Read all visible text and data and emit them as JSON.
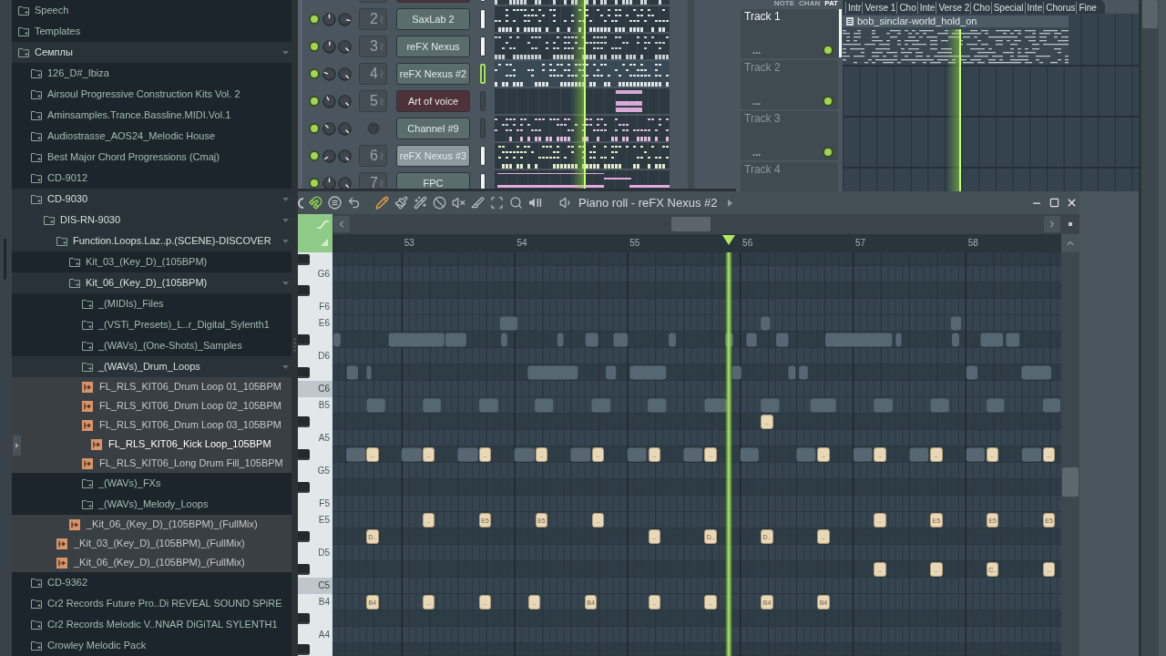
{
  "browser": {
    "items": [
      {
        "kind": "folder",
        "name": "Speech",
        "expanded": false,
        "selected": false
      },
      {
        "kind": "folder",
        "name": "Templates",
        "expanded": false,
        "selected": false
      },
      {
        "kind": "folder",
        "name": "Семплы",
        "expanded": true,
        "selected": false,
        "children": [
          {
            "kind": "folder",
            "name": "126_D#_Ibiza",
            "expanded": false,
            "selected": false
          },
          {
            "kind": "folder",
            "name": "Airsoul Progressive Construction Kits Vol. 2",
            "expanded": false,
            "selected": false
          },
          {
            "kind": "folder",
            "name": "Aminsamples.Trance.Bassline.MIDI.Vol.1",
            "expanded": false,
            "selected": false
          },
          {
            "kind": "folder",
            "name": "Audiostrasse_AOS24_Melodic House",
            "expanded": false,
            "selected": false
          },
          {
            "kind": "folder",
            "name": "Best Major Chord Progressions (Cmaj)",
            "expanded": false,
            "selected": false
          },
          {
            "kind": "folder",
            "name": "CD-9012",
            "expanded": false,
            "selected": false
          },
          {
            "kind": "folder",
            "name": "CD-9030",
            "expanded": true,
            "selected": false,
            "children": [
              {
                "kind": "folder",
                "name": "DIS-RN-9030",
                "expanded": true,
                "selected": false,
                "children": [
                  {
                    "kind": "folder",
                    "name": "Function.Loops.Laz..p.(SCENE)-DISCOVER",
                    "expanded": true,
                    "selected": false,
                    "children": [
                      {
                        "kind": "folder",
                        "name": "Kit_03_(Key_D)_(105BPM)",
                        "expanded": false,
                        "selected": false
                      },
                      {
                        "kind": "folder",
                        "name": "Kit_06_(Key_D)_(105BPM)",
                        "expanded": true,
                        "selected": false,
                        "children": [
                          {
                            "kind": "folder",
                            "name": "_(MIDIs)_Files",
                            "expanded": false,
                            "selected": false
                          },
                          {
                            "kind": "folder",
                            "name": "_(VSTi_Presets)_L..r_Digital_Sylenth1",
                            "expanded": false,
                            "selected": false
                          },
                          {
                            "kind": "folder",
                            "name": "_(WAVs)_(One-Shots)_Samples",
                            "expanded": false,
                            "selected": false
                          },
                          {
                            "kind": "folder",
                            "name": "_(WAVs)_Drum_Loops",
                            "expanded": true,
                            "selected": false,
                            "children": [
                              {
                                "kind": "file",
                                "name": "FL_RLS_KIT06_Drum Loop 01_105BPM",
                                "selected": false
                              },
                              {
                                "kind": "file",
                                "name": "FL_RLS_KIT06_Drum Loop 02_105BPM",
                                "selected": false
                              },
                              {
                                "kind": "file",
                                "name": "FL_RLS_KIT06_Drum Loop 03_105BPM",
                                "selected": false
                              },
                              {
                                "kind": "file",
                                "name": "FL_RLS_KIT06_Kick Loop_105BPM",
                                "selected": true
                              },
                              {
                                "kind": "file",
                                "name": "FL_RLS_KIT06_Long Drum Fill_105BPM",
                                "selected": false
                              }
                            ]
                          },
                          {
                            "kind": "folder",
                            "name": "_(WAVs)_FXs",
                            "expanded": false,
                            "selected": false
                          },
                          {
                            "kind": "folder",
                            "name": "_(WAVs)_Melody_Loops",
                            "expanded": false,
                            "selected": false
                          },
                          {
                            "kind": "file",
                            "name": "_Kit_06_(Key_D)_(105BPM)_(FullMix)",
                            "selected": false
                          }
                        ]
                      },
                      {
                        "kind": "file",
                        "name": "_Kit_03_(Key_D)_(105BPM)_(FullMix)",
                        "selected": false
                      },
                      {
                        "kind": "file",
                        "name": "_Kit_06_(Key_D)_(105BPM)_(FullMix)",
                        "selected": false
                      }
                    ]
                  }
                ]
              }
            ]
          },
          {
            "kind": "folder",
            "name": "CD-9362",
            "expanded": false,
            "selected": false
          },
          {
            "kind": "folder",
            "name": "Cr2 Records Future Pro..Di REVEAL SOUND SPiRE",
            "expanded": false,
            "selected": false
          },
          {
            "kind": "folder",
            "name": "Cr2 Records Melodic V..NNAR DiGiTAL SYLENTH1",
            "expanded": false,
            "selected": false
          },
          {
            "kind": "folder",
            "name": "Crowley Melodic Pack",
            "expanded": false,
            "selected": false
          }
        ]
      }
    ]
  },
  "channel_rack": {
    "channels": [
      {
        "kind": "mixer",
        "color": "#4f3239",
        "selected": true,
        "focused": false,
        "preview": {
          "kind": "dots",
          "color": "#d3d9dc"
        }
      },
      {
        "kind": "mixer",
        "number": "2",
        "name": "SaxLab 2",
        "color": "#5a6d6c",
        "selected": true,
        "focused": false,
        "on": true,
        "preview": {
          "kind": "dots",
          "color": "#dbe2e5"
        }
      },
      {
        "kind": "mixer",
        "number": "3",
        "name": "reFX Nexus",
        "color": "#5a6d6c",
        "selected": true,
        "focused": false,
        "on": true,
        "preview": {
          "kind": "dots",
          "color": "#c8cfd3"
        }
      },
      {
        "kind": "mixer",
        "number": "4",
        "name": "reFX Nexus #2",
        "color": "#5a6d6c",
        "selected": false,
        "focused": true,
        "on": true,
        "preview": {
          "kind": "dots",
          "color": "#dde3e6"
        }
      },
      {
        "kind": "mixer",
        "number": "5",
        "name": "Art of voice",
        "color": "#4f3239",
        "selected": false,
        "focused": false,
        "on": true,
        "preview": {
          "kind": "blocks",
          "color": "#d8a8d6"
        }
      },
      {
        "kind": "midi",
        "name": "Channel #9",
        "color": "#5a6d6c",
        "selected": false,
        "focused": false,
        "on": true,
        "preview": {
          "kind": "dots",
          "color": "#e0bde0"
        }
      },
      {
        "kind": "mixer",
        "number": "6",
        "name": "reFX Nexus #3",
        "color": "#8c999f",
        "selected": true,
        "focused": false,
        "on": true,
        "preview": {
          "kind": "dots",
          "color": "#e4ebcb"
        }
      },
      {
        "kind": "mixer",
        "number": "7",
        "name": "FPC",
        "color": "#5a6d6c",
        "selected": true,
        "focused": false,
        "on": true,
        "preview": {
          "kind": "bars",
          "color": "#e3a9df"
        }
      }
    ]
  },
  "playlist": {
    "modes": [
      {
        "label": "NOTE",
        "selected": false
      },
      {
        "label": "CHAN",
        "selected": false
      },
      {
        "label": "PAT",
        "selected": true
      }
    ],
    "markers": [
      "Intr",
      "Verse 1",
      "Cho",
      "Inte",
      "Verse 2",
      "Cho",
      "Special",
      "Inte",
      "Chorus",
      "Fine"
    ],
    "tracks": [
      {
        "name": "Track 1",
        "selected": true,
        "on": true,
        "more": "...",
        "clips": [
          {
            "title": "bob_sinclar-world_hold_on"
          }
        ]
      },
      {
        "name": "Track 2",
        "selected": false,
        "on": true,
        "more": "..."
      },
      {
        "name": "Track 3",
        "selected": false,
        "on": true,
        "more": "..."
      },
      {
        "name": "Track 4",
        "selected": false
      }
    ]
  },
  "piano_roll": {
    "title": "Piano roll - reFX Nexus #2",
    "ruler": [
      "53",
      "54",
      "55",
      "56",
      "57",
      "58"
    ],
    "rows": [
      {
        "kind": "black"
      },
      {
        "kind": "white",
        "label": "G6"
      },
      {
        "kind": "black"
      },
      {
        "kind": "white",
        "label": "F6"
      },
      {
        "kind": "white",
        "label": "E6"
      },
      {
        "kind": "black"
      },
      {
        "kind": "white",
        "label": "D6"
      },
      {
        "kind": "black"
      },
      {
        "kind": "octave",
        "label": "C6"
      },
      {
        "kind": "white",
        "label": "B5"
      },
      {
        "kind": "black",
        "notes": [
          {
            "label": ".."
          }
        ]
      },
      {
        "kind": "white",
        "label": "A5"
      },
      {
        "kind": "black",
        "notes": [
          {
            "label": ".."
          },
          {
            "label": ".."
          },
          {
            "label": ".."
          },
          {
            "label": ".."
          },
          {
            "label": ".."
          },
          {
            "label": ".."
          },
          {
            "label": ".."
          },
          {
            "label": ".."
          },
          {
            "label": ".."
          },
          {
            "label": ".."
          },
          {
            "label": ".."
          },
          {
            "label": ".."
          }
        ]
      },
      {
        "kind": "white",
        "label": "G5"
      },
      {
        "kind": "black"
      },
      {
        "kind": "white",
        "label": "F5"
      },
      {
        "kind": "white",
        "label": "E5",
        "notes": [
          {
            "label": ".."
          },
          {
            "label": "E5"
          },
          {
            "label": "E5"
          },
          {
            "label": ".."
          },
          {
            "label": ".."
          },
          {
            "label": "E5"
          },
          {
            "label": "E5"
          },
          {
            "label": "E5"
          }
        ]
      },
      {
        "kind": "black",
        "notes": [
          {
            "label": "D.."
          },
          {
            "label": ".."
          },
          {
            "label": "D.."
          },
          {
            "label": "D.."
          },
          {
            "label": ".."
          }
        ]
      },
      {
        "kind": "white",
        "label": "D5"
      },
      {
        "kind": "black",
        "notes": [
          {
            "label": ".."
          },
          {
            "label": ".."
          },
          {
            "label": "C.."
          },
          {
            "label": ".."
          }
        ]
      },
      {
        "kind": "octave",
        "label": "C5"
      },
      {
        "kind": "white",
        "label": "B4",
        "notes": [
          {
            "label": "B4"
          },
          {
            "label": ".."
          },
          {
            "label": ".."
          },
          {
            "label": ".."
          },
          {
            "label": "B4"
          },
          {
            "label": ".."
          },
          {
            "label": ".."
          },
          {
            "label": "B4"
          },
          {
            "label": "B4"
          }
        ]
      },
      {
        "kind": "black"
      },
      {
        "kind": "white",
        "label": "A4"
      },
      {
        "kind": "black"
      }
    ]
  }
}
